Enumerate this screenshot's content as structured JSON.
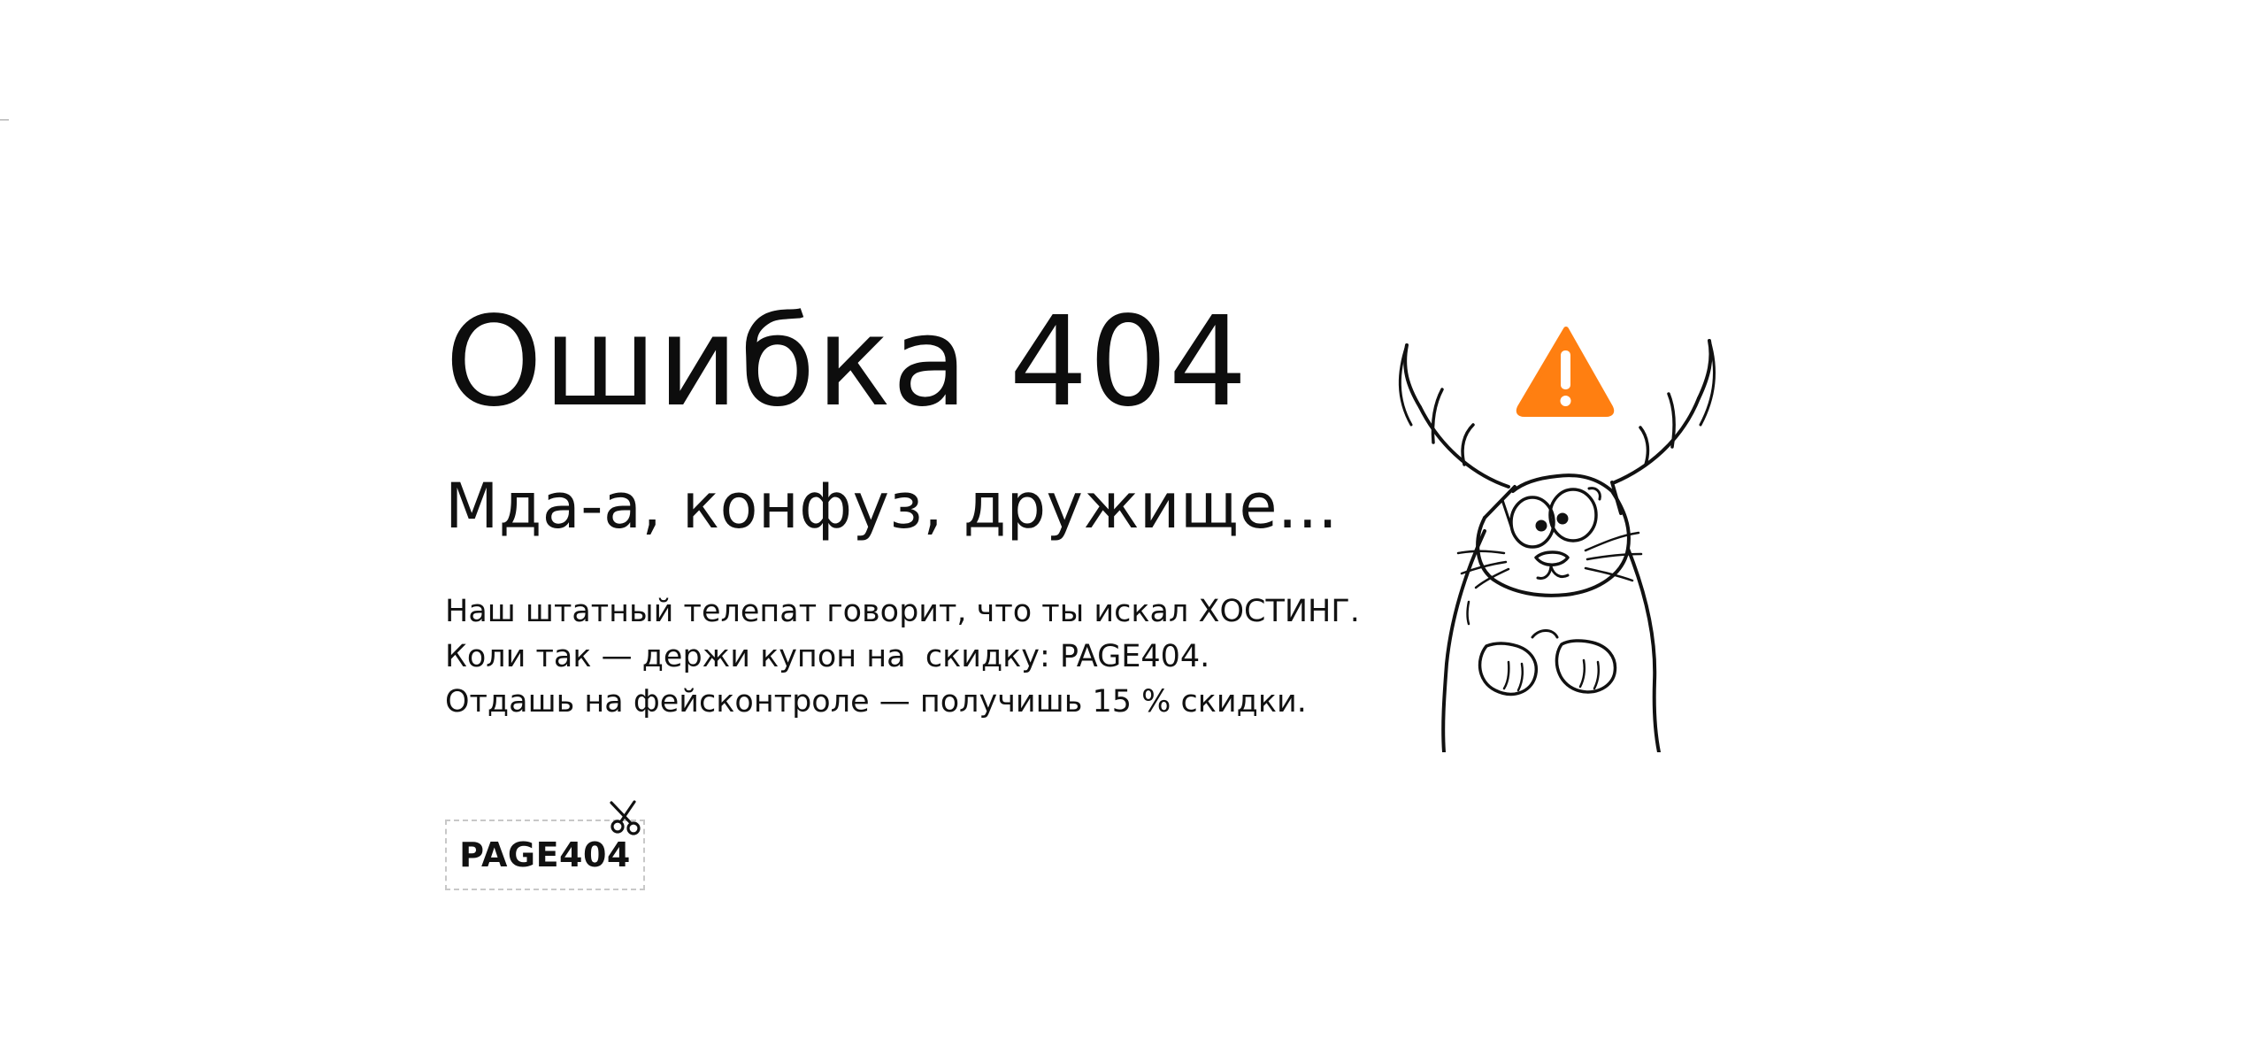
{
  "error": {
    "title": "Ошибка 404",
    "subtitle": "Мда-а, конфуз, дружище...",
    "lines": [
      "Наш штатный телепат говорит, что ты искал ХОСТИНГ.",
      "Коли так — держи купон на  скидку: PAGE404.",
      "Отдашь на фейсконтроле — получишь 15 % скидки."
    ]
  },
  "coupon": {
    "code": "PAGE404",
    "icon": "scissors-icon"
  },
  "illustration": {
    "name": "confused-deer-cat",
    "warning_icon": "warning-triangle-icon",
    "warning_color": "#ff7f11",
    "line_color": "#111111"
  }
}
